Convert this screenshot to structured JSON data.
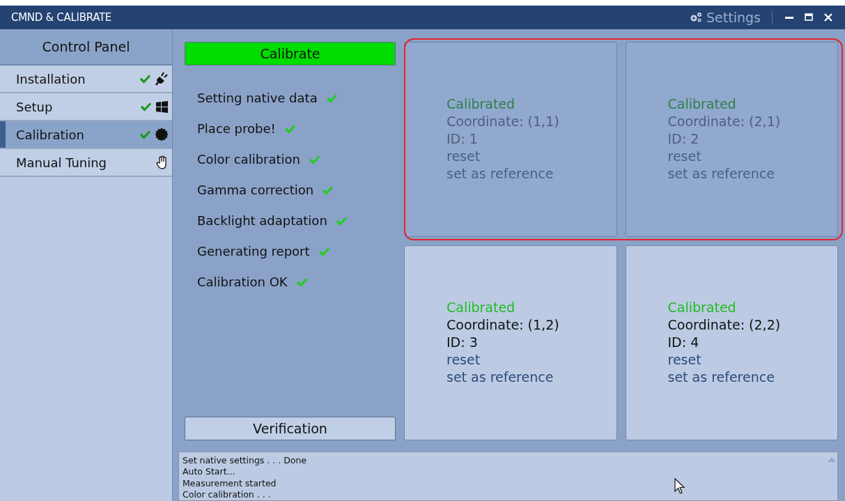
{
  "window": {
    "title": "CMND & CALIBRATE",
    "settings_label": "Settings"
  },
  "sidebar": {
    "header": "Control Panel",
    "items": [
      {
        "label": "Installation",
        "done": true,
        "selected": false
      },
      {
        "label": "Setup",
        "done": true,
        "selected": false
      },
      {
        "label": "Calibration",
        "done": true,
        "selected": true
      },
      {
        "label": "Manual Tuning",
        "done": false,
        "selected": false
      }
    ]
  },
  "calibrate_button": "Calibrate",
  "steps": [
    {
      "label": "Setting native data",
      "done": true
    },
    {
      "label": "Place probe!",
      "done": true
    },
    {
      "label": "Color calibration",
      "done": true
    },
    {
      "label": "Gamma correction",
      "done": true
    },
    {
      "label": "Backlight adaptation",
      "done": true
    },
    {
      "label": "Generating report",
      "done": true
    },
    {
      "label": "Calibration OK",
      "done": true
    }
  ],
  "verification_button": "Verification",
  "card_rows": [
    {
      "highlighted": true,
      "cards": [
        {
          "status": "Calibrated",
          "coordinate": "Coordinate: (1,1)",
          "id": "ID: 1",
          "reset": "reset",
          "reference": "set as reference",
          "disabled": true
        },
        {
          "status": "Calibrated",
          "coordinate": "Coordinate: (2,1)",
          "id": "ID: 2",
          "reset": "reset",
          "reference": "set as reference",
          "disabled": true
        }
      ]
    },
    {
      "highlighted": false,
      "cards": [
        {
          "status": "Calibrated",
          "coordinate": "Coordinate: (1,2)",
          "id": "ID: 3",
          "reset": "reset",
          "reference": "set as reference",
          "disabled": false
        },
        {
          "status": "Calibrated",
          "coordinate": "Coordinate: (2,2)",
          "id": "ID: 4",
          "reset": "reset",
          "reference": "set as reference",
          "disabled": false
        }
      ]
    }
  ],
  "log": [
    "Set native settings . . . Done",
    "Auto Start...",
    "Measurement started",
    "Color calibration . . ."
  ]
}
